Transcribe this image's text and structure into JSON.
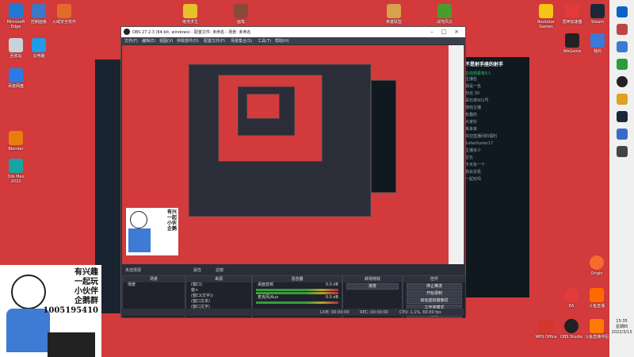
{
  "desktop": {
    "icons_left": [
      {
        "label": "Microsoft Edge",
        "color": "#1f7ad6"
      },
      {
        "label": "回收站",
        "color": "#c9d1d9"
      },
      {
        "label": "百度网盘",
        "color": "#2a7be4"
      },
      {
        "label": "Blender",
        "color": "#e87d0d"
      },
      {
        "label": "3ds Max 2022",
        "color": "#1aa3a3"
      }
    ],
    "icons_top": [
      {
        "label": "控制面板",
        "color": "#3b78c6"
      },
      {
        "label": "火绒安全软件",
        "color": "#e46a2b"
      },
      {
        "label": "云电脑",
        "color": "#1e9be9"
      },
      {
        "label": "绝地求生",
        "color": "#e6c229"
      },
      {
        "label": "画笔",
        "color": "#8a4a3a"
      },
      {
        "label": "英雄联盟",
        "color": "#d6a24a"
      },
      {
        "label": "战地风云",
        "color": "#4a9d2b"
      }
    ],
    "icons_right": [
      {
        "label": "Rockstar Games",
        "color": "#f5c518"
      },
      {
        "label": "雷神加速器",
        "color": "#e23a3a"
      },
      {
        "label": "Steam",
        "color": "#1b2838"
      },
      {
        "label": "WeGame",
        "color": "#222222"
      },
      {
        "label": "我的",
        "color": "#3b7ad6"
      },
      {
        "label": "Origin",
        "color": "#f56c2d"
      },
      {
        "label": "EA",
        "color": "#e23b3b"
      },
      {
        "label": "斗鱼直播",
        "color": "#ff6a00"
      },
      {
        "label": "WPS Office",
        "color": "#d4382c"
      },
      {
        "label": "OBS Studio",
        "color": "#222222"
      },
      {
        "label": "斗鱼直播伴侣",
        "color": "#ff7a00"
      }
    ]
  },
  "obs": {
    "title": "OBS 27.2.3 (64-bit, windows) - 配置文件: 未命名 - 场景: 未命名",
    "menu": [
      "文件(F)",
      "编辑(E)",
      "视图(V)",
      "停靠部件(D)",
      "配置文件(P)",
      "场景集合(S)",
      "工具(T)",
      "帮助(H)"
    ],
    "dock_labels": [
      "未选择源",
      "属性",
      "滤镜"
    ],
    "scenes": {
      "header": "场景",
      "items": [
        "场景"
      ]
    },
    "sources": {
      "header": "来源",
      "items": [
        "(窗口)",
        "窗+",
        "(窗口(文字))",
        "(窗口文本)",
        "(窗口文字)",
        "(窗口(文字))"
      ]
    },
    "mixer": {
      "header": "混音器",
      "channels": [
        {
          "name": "桌面音频",
          "level": "0.0 dB"
        },
        {
          "name": "麦克风/Aux",
          "level": "0.0 dB"
        }
      ]
    },
    "transitions": {
      "header": "转场特效",
      "value": "渐变"
    },
    "controls": {
      "header": "控件",
      "buttons": [
        "停止推流",
        "开始录制",
        "启动虚拟摄像机",
        "工作室模式",
        "设置",
        "退出"
      ]
    },
    "status": {
      "live": "LIVE: 00:00:00",
      "rec": "REC: 00:00:00",
      "cpu": "CPU: 1.1%, 60.00 fps"
    }
  },
  "chat": {
    "title": "不是射手座的射手",
    "online": "在线观看有5人",
    "lines": [
      "主播名",
      "我是一名",
      "粉丝 30",
      "青石率001号",
      "游戏主播",
      "有趣的",
      "大家好",
      "来来来",
      "欢迎直播间的福利",
      "1ofanfuster17",
      "主播多少",
      "拉长",
      "今天有一个",
      "我会去看",
      "一起玩吗"
    ]
  },
  "meme": {
    "lines": [
      "有兴趣",
      "一起玩",
      "小伙伴",
      "企鹅群",
      "1005195410"
    ]
  },
  "meme_small": {
    "lines": [
      "有兴",
      "一起",
      "小伙",
      "企鹅"
    ]
  },
  "taskbar": {
    "time": "15:35",
    "weekday": "星期四",
    "date": "2022/3/13"
  }
}
